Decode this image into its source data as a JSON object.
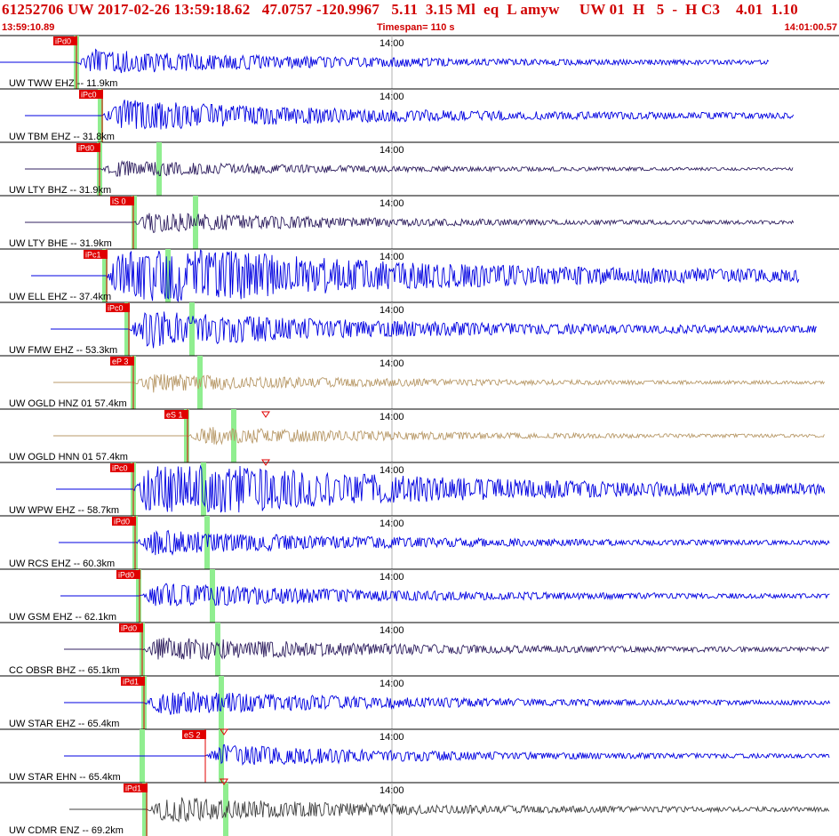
{
  "header": {
    "title": "61252706 UW 2017-02-26 13:59:18.62   47.0757 -120.9967   5.11  3.15 Ml  eq  L amyw     UW 01  H   5  -  H C3    4.01  1.10",
    "start_time": "13:59:10.89",
    "timespan": "Timespan= 110 s",
    "end_time": "14:01:00.57"
  },
  "colors": {
    "title_red": "#d00000",
    "trace_blue": "#0000e0",
    "trace_tan": "#b89968",
    "trace_navy": "#302060",
    "trace_gray": "#404040",
    "pick_red": "#e00000",
    "pick_green": "#90ee90",
    "grid_line": "#b0b0b0"
  },
  "time_tick_label": "14:00",
  "channels": [
    {
      "label": "UW TWW EHZ -- 11.9km",
      "pick": "iPd0",
      "color": "blue",
      "amp": 0.55,
      "start": 0.0
    },
    {
      "label": "UW TBM EHZ -- 31.8km",
      "pick": "iPc0",
      "color": "blue",
      "amp": 0.7,
      "start": 0.03
    },
    {
      "label": "UW LTY BHZ -- 31.9km",
      "pick": "iPd0",
      "color": "navy",
      "amp": 0.35,
      "start": 0.03
    },
    {
      "label": "UW LTY BHE -- 31.9km",
      "pick": "iS 0",
      "color": "navy",
      "amp": 0.45,
      "start": 0.03
    },
    {
      "label": "UW ELL EHZ -- 37.4km",
      "pick": "iPc1",
      "color": "blue",
      "amp": 1.0,
      "start": 0.04
    },
    {
      "label": "UW FMW EHZ -- 53.3km",
      "pick": "iPc0",
      "color": "blue",
      "amp": 0.85,
      "start": 0.07
    },
    {
      "label": "UW OGLD HNZ 01 57.4km",
      "pick": "eP 3",
      "color": "tan",
      "amp": 0.4,
      "start": 0.07
    },
    {
      "label": "UW OGLD HNN 01 57.4km",
      "pick": "eS 1",
      "color": "tan",
      "amp": 0.4,
      "start": 0.07
    },
    {
      "label": "UW WPW EHZ -- 58.7km",
      "pick": "iPc0",
      "color": "blue",
      "amp": 0.9,
      "start": 0.07
    },
    {
      "label": "UW RCS EHZ -- 60.3km",
      "pick": "iPd0",
      "color": "blue",
      "amp": 0.55,
      "start": 0.07
    },
    {
      "label": "UW GSM EHZ -- 62.1km",
      "pick": "iPd0",
      "color": "blue",
      "amp": 0.55,
      "start": 0.07
    },
    {
      "label": "CC OBSR BHZ -- 65.1km",
      "pick": "iPd0",
      "color": "navy",
      "amp": 0.55,
      "start": 0.08
    },
    {
      "label": "UW STAR EHZ -- 65.4km",
      "pick": "iPd1",
      "color": "blue",
      "amp": 0.55,
      "start": 0.08
    },
    {
      "label": "UW STAR EHN -- 65.4km",
      "pick": "eS 2",
      "color": "blue",
      "amp": 0.5,
      "start": 0.08
    },
    {
      "label": "UW CDMR ENZ -- 69.2km",
      "pick": "iPd1",
      "color": "gray",
      "amp": 0.55,
      "start": 0.08
    }
  ]
}
